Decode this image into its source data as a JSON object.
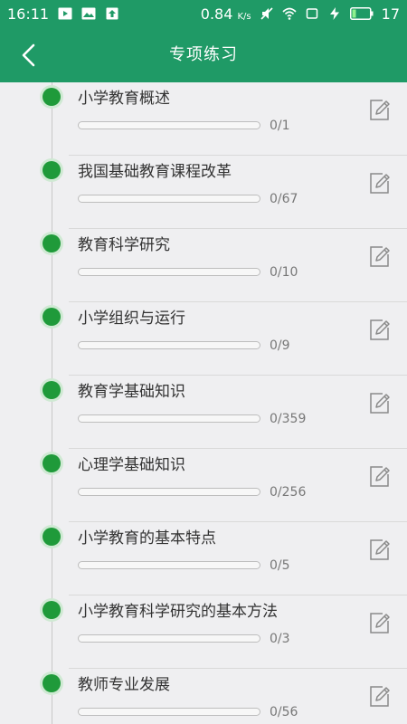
{
  "status_bar": {
    "time": "16:11",
    "speed": "0.84",
    "speed_unit": "K/s",
    "battery": "17"
  },
  "header": {
    "title": "专项练习"
  },
  "items": [
    {
      "title": "小学教育概述",
      "progress": "0/1",
      "done": 0,
      "total": 1
    },
    {
      "title": "我国基础教育课程改革",
      "progress": "0/67",
      "done": 0,
      "total": 67
    },
    {
      "title": "教育科学研究",
      "progress": "0/10",
      "done": 0,
      "total": 10
    },
    {
      "title": "小学组织与运行",
      "progress": "0/9",
      "done": 0,
      "total": 9
    },
    {
      "title": "教育学基础知识",
      "progress": "0/359",
      "done": 0,
      "total": 359
    },
    {
      "title": "心理学基础知识",
      "progress": "0/256",
      "done": 0,
      "total": 256
    },
    {
      "title": "小学教育的基本特点",
      "progress": "0/5",
      "done": 0,
      "total": 5
    },
    {
      "title": "小学教育科学研究的基本方法",
      "progress": "0/3",
      "done": 0,
      "total": 3
    },
    {
      "title": "教师专业发展",
      "progress": "0/56",
      "done": 0,
      "total": 56
    }
  ],
  "colors": {
    "brand": "#1f9a66",
    "dot": "#1f9a3a"
  }
}
